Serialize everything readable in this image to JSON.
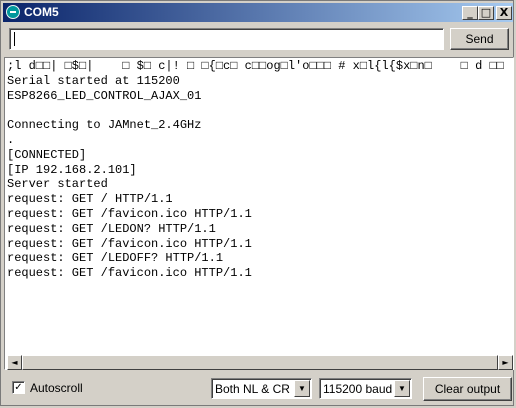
{
  "window": {
    "title": "COM5",
    "controls": {
      "minimize": "_",
      "maximize": "□",
      "close": "X"
    }
  },
  "send": {
    "input_value": "",
    "button_label": "Send"
  },
  "output": {
    "lines": [
      ";l d□□| □$□|    □ $□ c|! □ □{□c□ c□□og□l'o□□□ # x□l{l{$x□n□    □ d □□    c g□",
      "Serial started at 115200",
      "ESP8266_LED_CONTROL_AJAX_01",
      "",
      "Connecting to JAMnet_2.4GHz",
      ".",
      "[CONNECTED]",
      "[IP 192.168.2.101]",
      "Server started",
      "request: GET / HTTP/1.1",
      "request: GET /favicon.ico HTTP/1.1",
      "request: GET /LEDON? HTTP/1.1",
      "request: GET /favicon.ico HTTP/1.1",
      "request: GET /LEDOFF? HTTP/1.1",
      "request: GET /favicon.ico HTTP/1.1"
    ]
  },
  "scrollbar": {
    "left_arrow": "◄",
    "right_arrow": "►"
  },
  "bottom": {
    "autoscroll_label": "Autoscroll",
    "autoscroll_checked": "✓",
    "line_ending": "Both NL & CR",
    "baud": "115200 baud",
    "dropdown_arrow": "▼",
    "clear_label": "Clear output"
  },
  "icons": {
    "app": "arduino-icon"
  }
}
